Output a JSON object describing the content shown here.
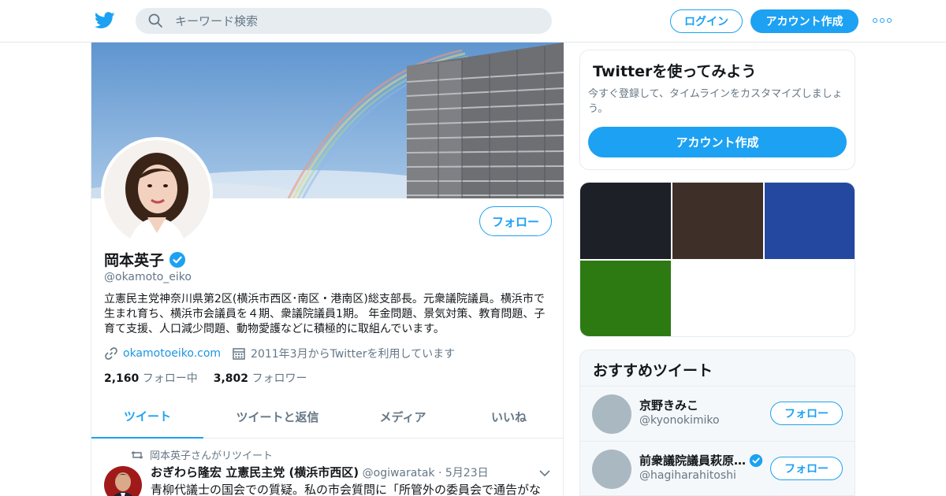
{
  "header": {
    "search_placeholder": "キーワード検索",
    "login_label": "ログイン",
    "signup_label": "アカウント作成"
  },
  "profile": {
    "name": "岡本英子",
    "handle": "@okamoto_eiko",
    "follow_label": "フォロー",
    "bio": "立憲民主党神奈川県第2区(横浜市西区･南区・港南区)総支部長。元衆議院議員。横浜市で生まれ育ち、横浜市会議員を４期、衆議院議員1期。 年金問題、景気対策、教育問題、子育て支援、人口減少問題、動物愛護などに積極的に取組んでいます。",
    "website": "okamotoeiko.com",
    "joined": "2011年3月からTwitterを利用しています",
    "following_count": "2,160",
    "following_label": "フォロー中",
    "followers_count": "3,802",
    "followers_label": "フォロワー",
    "tabs": [
      "ツイート",
      "ツイートと返信",
      "メディア",
      "いいね"
    ]
  },
  "tweet": {
    "retweeted_by": "岡本英子さんがリツイート",
    "author_name": "おぎわら隆宏 立憲民主党 (横浜市西区)",
    "author_handle": "@ogiwaratak",
    "date": "5月23日",
    "text": "青柳代議士の国会での質疑。私の市会質問に「所管外の委員会で通告がな"
  },
  "sidebar": {
    "try_title": "Twitterを使ってみよう",
    "try_desc": "今すぐ登録して、タイムラインをカスタマイズしましょう。",
    "try_button": "アカウント作成",
    "media_colors": [
      "#1d2026",
      "#3e3029",
      "#2448a0",
      "#2d7a12"
    ],
    "rec_title": "おすすめツイート",
    "recommendations": [
      {
        "name": "京野きみこ",
        "handle": "@kyonokimiko",
        "follow_label": "フォロー"
      },
      {
        "name": "前衆議院議員萩原…",
        "handle": "@hagiharahitoshi",
        "follow_label": "フォロー"
      }
    ]
  },
  "colors": {
    "accent": "#1da1f2",
    "muted": "#657786"
  }
}
